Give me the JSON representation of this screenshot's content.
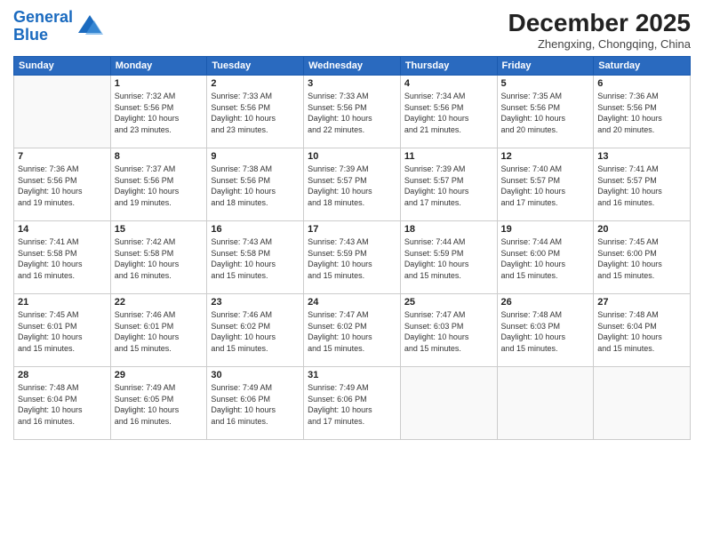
{
  "logo": {
    "line1": "General",
    "line2": "Blue"
  },
  "title": "December 2025",
  "subtitle": "Zhengxing, Chongqing, China",
  "headers": [
    "Sunday",
    "Monday",
    "Tuesday",
    "Wednesday",
    "Thursday",
    "Friday",
    "Saturday"
  ],
  "weeks": [
    [
      {
        "day": "",
        "info": ""
      },
      {
        "day": "1",
        "info": "Sunrise: 7:32 AM\nSunset: 5:56 PM\nDaylight: 10 hours\nand 23 minutes."
      },
      {
        "day": "2",
        "info": "Sunrise: 7:33 AM\nSunset: 5:56 PM\nDaylight: 10 hours\nand 23 minutes."
      },
      {
        "day": "3",
        "info": "Sunrise: 7:33 AM\nSunset: 5:56 PM\nDaylight: 10 hours\nand 22 minutes."
      },
      {
        "day": "4",
        "info": "Sunrise: 7:34 AM\nSunset: 5:56 PM\nDaylight: 10 hours\nand 21 minutes."
      },
      {
        "day": "5",
        "info": "Sunrise: 7:35 AM\nSunset: 5:56 PM\nDaylight: 10 hours\nand 20 minutes."
      },
      {
        "day": "6",
        "info": "Sunrise: 7:36 AM\nSunset: 5:56 PM\nDaylight: 10 hours\nand 20 minutes."
      }
    ],
    [
      {
        "day": "7",
        "info": "Sunrise: 7:36 AM\nSunset: 5:56 PM\nDaylight: 10 hours\nand 19 minutes."
      },
      {
        "day": "8",
        "info": "Sunrise: 7:37 AM\nSunset: 5:56 PM\nDaylight: 10 hours\nand 19 minutes."
      },
      {
        "day": "9",
        "info": "Sunrise: 7:38 AM\nSunset: 5:56 PM\nDaylight: 10 hours\nand 18 minutes."
      },
      {
        "day": "10",
        "info": "Sunrise: 7:39 AM\nSunset: 5:57 PM\nDaylight: 10 hours\nand 18 minutes."
      },
      {
        "day": "11",
        "info": "Sunrise: 7:39 AM\nSunset: 5:57 PM\nDaylight: 10 hours\nand 17 minutes."
      },
      {
        "day": "12",
        "info": "Sunrise: 7:40 AM\nSunset: 5:57 PM\nDaylight: 10 hours\nand 17 minutes."
      },
      {
        "day": "13",
        "info": "Sunrise: 7:41 AM\nSunset: 5:57 PM\nDaylight: 10 hours\nand 16 minutes."
      }
    ],
    [
      {
        "day": "14",
        "info": "Sunrise: 7:41 AM\nSunset: 5:58 PM\nDaylight: 10 hours\nand 16 minutes."
      },
      {
        "day": "15",
        "info": "Sunrise: 7:42 AM\nSunset: 5:58 PM\nDaylight: 10 hours\nand 16 minutes."
      },
      {
        "day": "16",
        "info": "Sunrise: 7:43 AM\nSunset: 5:58 PM\nDaylight: 10 hours\nand 15 minutes."
      },
      {
        "day": "17",
        "info": "Sunrise: 7:43 AM\nSunset: 5:59 PM\nDaylight: 10 hours\nand 15 minutes."
      },
      {
        "day": "18",
        "info": "Sunrise: 7:44 AM\nSunset: 5:59 PM\nDaylight: 10 hours\nand 15 minutes."
      },
      {
        "day": "19",
        "info": "Sunrise: 7:44 AM\nSunset: 6:00 PM\nDaylight: 10 hours\nand 15 minutes."
      },
      {
        "day": "20",
        "info": "Sunrise: 7:45 AM\nSunset: 6:00 PM\nDaylight: 10 hours\nand 15 minutes."
      }
    ],
    [
      {
        "day": "21",
        "info": "Sunrise: 7:45 AM\nSunset: 6:01 PM\nDaylight: 10 hours\nand 15 minutes."
      },
      {
        "day": "22",
        "info": "Sunrise: 7:46 AM\nSunset: 6:01 PM\nDaylight: 10 hours\nand 15 minutes."
      },
      {
        "day": "23",
        "info": "Sunrise: 7:46 AM\nSunset: 6:02 PM\nDaylight: 10 hours\nand 15 minutes."
      },
      {
        "day": "24",
        "info": "Sunrise: 7:47 AM\nSunset: 6:02 PM\nDaylight: 10 hours\nand 15 minutes."
      },
      {
        "day": "25",
        "info": "Sunrise: 7:47 AM\nSunset: 6:03 PM\nDaylight: 10 hours\nand 15 minutes."
      },
      {
        "day": "26",
        "info": "Sunrise: 7:48 AM\nSunset: 6:03 PM\nDaylight: 10 hours\nand 15 minutes."
      },
      {
        "day": "27",
        "info": "Sunrise: 7:48 AM\nSunset: 6:04 PM\nDaylight: 10 hours\nand 15 minutes."
      }
    ],
    [
      {
        "day": "28",
        "info": "Sunrise: 7:48 AM\nSunset: 6:04 PM\nDaylight: 10 hours\nand 16 minutes."
      },
      {
        "day": "29",
        "info": "Sunrise: 7:49 AM\nSunset: 6:05 PM\nDaylight: 10 hours\nand 16 minutes."
      },
      {
        "day": "30",
        "info": "Sunrise: 7:49 AM\nSunset: 6:06 PM\nDaylight: 10 hours\nand 16 minutes."
      },
      {
        "day": "31",
        "info": "Sunrise: 7:49 AM\nSunset: 6:06 PM\nDaylight: 10 hours\nand 17 minutes."
      },
      {
        "day": "",
        "info": ""
      },
      {
        "day": "",
        "info": ""
      },
      {
        "day": "",
        "info": ""
      }
    ]
  ]
}
